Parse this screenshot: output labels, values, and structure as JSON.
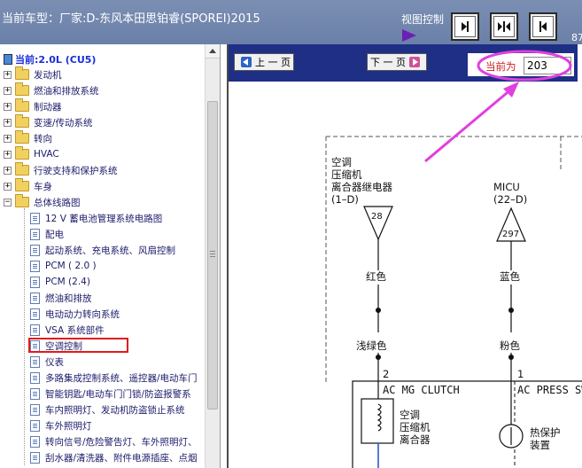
{
  "header": {
    "model_text": "当前车型：厂家:D-东风本田思铂睿(SPOREI)2015",
    "view_control_label": "视图控制",
    "right_edge_text": "87"
  },
  "tree": {
    "current": "当前:2.0L (CU5)",
    "folders": [
      {
        "label": "发动机",
        "expanded": false
      },
      {
        "label": "燃油和排放系统",
        "expanded": false
      },
      {
        "label": "制动器",
        "expanded": false
      },
      {
        "label": "变速/传动系统",
        "expanded": false
      },
      {
        "label": "转向",
        "expanded": false
      },
      {
        "label": "HVAC",
        "expanded": false
      },
      {
        "label": "行驶支持和保护系统",
        "expanded": false
      },
      {
        "label": "车身",
        "expanded": false
      },
      {
        "label": "总体线路图",
        "expanded": true
      }
    ],
    "docs": [
      "12 V 蓄电池管理系统电路图",
      "配电",
      "起动系统、充电系统、风扇控制",
      "PCM ( 2.0 )",
      "PCM (2.4)",
      "燃油和排放",
      "电动动力转向系统",
      "VSA 系统部件",
      "空调控制",
      "仪表",
      "多路集成控制系统、遥控器/电动车门",
      "智能钥匙/电动车门门锁/防盗报警系",
      "车内照明灯、发动机防盗锁止系统",
      "车外照明灯",
      "转向信号/危险警告灯、车外照明灯、",
      "刮水器/清洗器、附件电源插座、点烟"
    ],
    "selected": "空调控制"
  },
  "toolbar": {
    "prev_label": "上 一 页",
    "next_label": "下 一 页",
    "current_page_label": "当前为",
    "current_page_value": "203"
  },
  "diagram": {
    "left_component": [
      "空调",
      "压缩机",
      "离合器继电器",
      "(1–D)"
    ],
    "left_connector": "28",
    "left_wire_color_1": "红色",
    "left_wire_color_2": "浅绿色",
    "left_pin": "2",
    "right_component": [
      "MICU",
      "(22–D)"
    ],
    "right_connector": "297",
    "right_wire_color_1": "蓝色",
    "right_wire_color_2": "粉色",
    "right_pin": "1",
    "clutch_label": "AC MG CLUTCH",
    "clutch_desc": [
      "空调",
      "压缩机",
      "离合器"
    ],
    "press_label": "AC PRESS SW",
    "press_desc": [
      "热保护",
      "装置"
    ]
  },
  "colors": {
    "header_bg": "#7b8fb3",
    "toolbar_bg": "#1f2f86",
    "highlight": "#e21b1b",
    "annotation": "#e040e0"
  }
}
